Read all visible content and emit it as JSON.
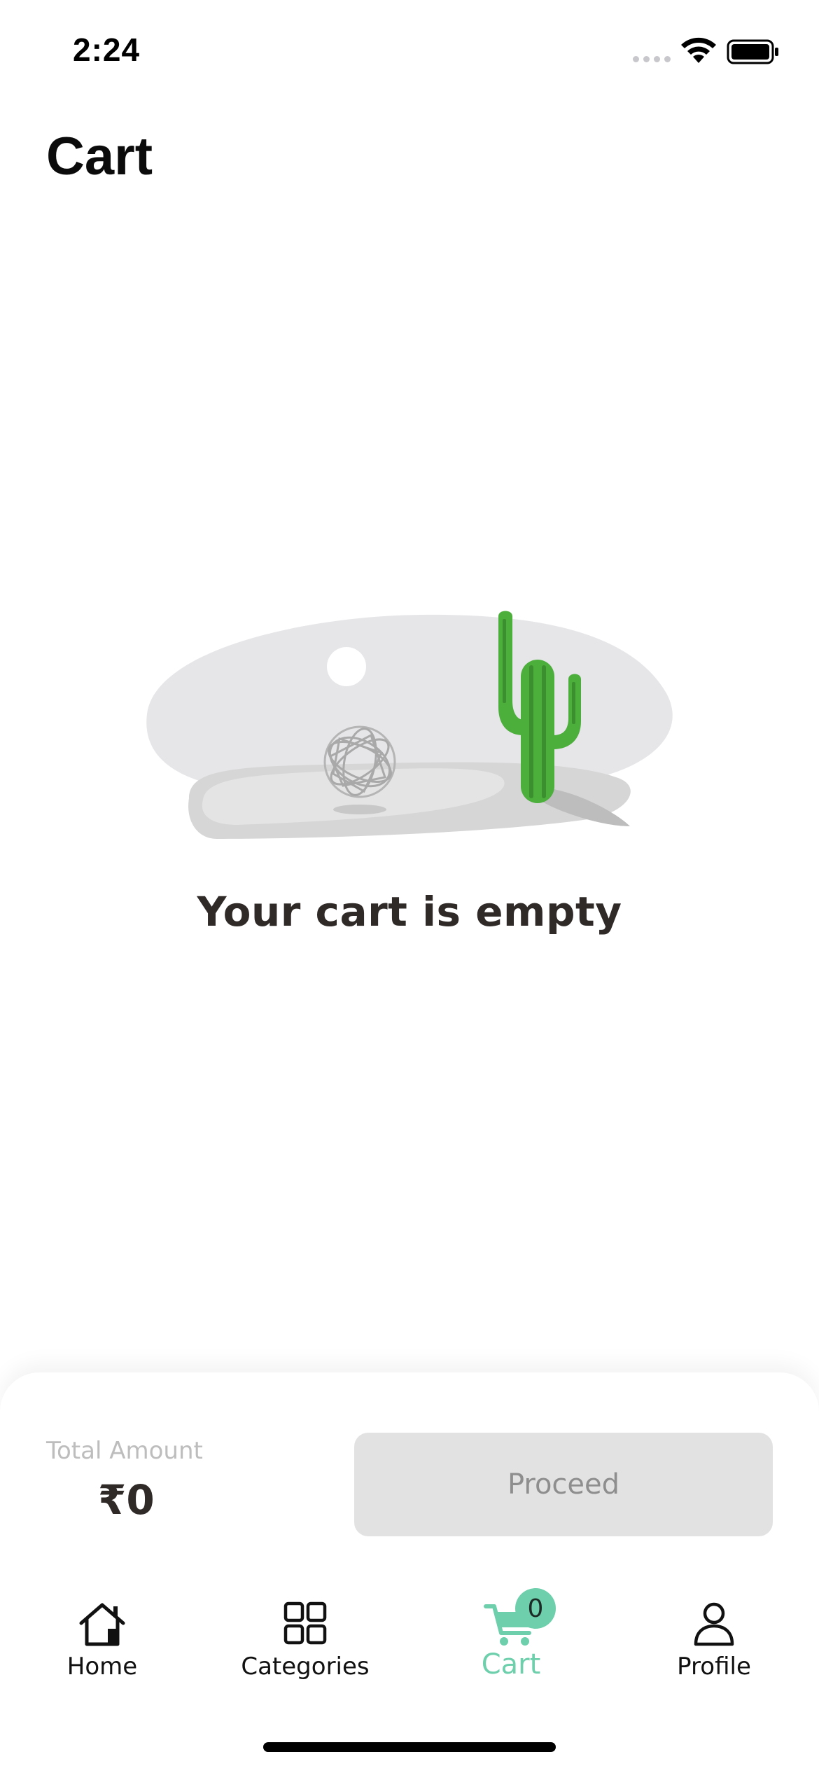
{
  "status_bar": {
    "time": "2:24"
  },
  "header": {
    "title": "Cart"
  },
  "empty_state": {
    "message": "Your cart is empty",
    "illustration": "cactus-desert-illustration"
  },
  "checkout": {
    "total_label": "Total Amount",
    "total_value": "₹0",
    "proceed_label": "Proceed"
  },
  "tab_bar": {
    "items": [
      {
        "label": "Home",
        "icon": "home-icon"
      },
      {
        "label": "Categories",
        "icon": "grid-icon"
      },
      {
        "label": "Cart",
        "icon": "cart-icon",
        "active": true,
        "badge": "0"
      },
      {
        "label": "Profile",
        "icon": "person-icon"
      }
    ]
  },
  "colors": {
    "accent": "#6dcfac",
    "disabled_button": "#e2e2e2",
    "text_dark": "#2f2a28"
  }
}
